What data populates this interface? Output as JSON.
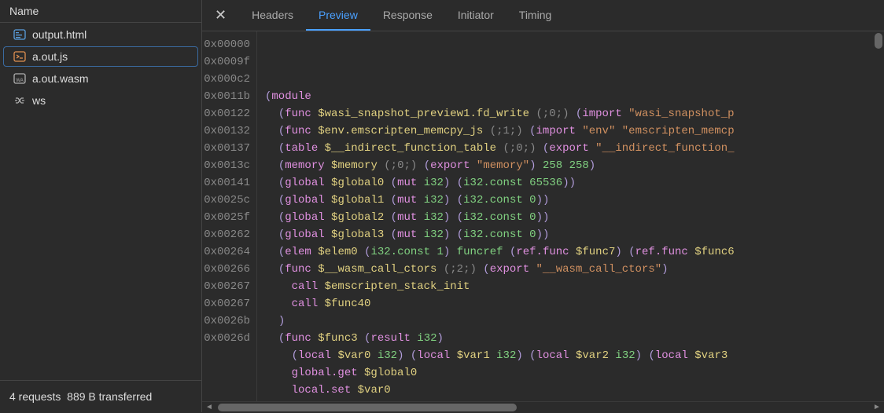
{
  "sidebar": {
    "header": "Name",
    "files": [
      {
        "name": "output.html",
        "icon": "html-icon",
        "selected": false
      },
      {
        "name": "a.out.js",
        "icon": "js-icon",
        "selected": true
      },
      {
        "name": "a.out.wasm",
        "icon": "wasm-icon",
        "selected": false
      },
      {
        "name": "ws",
        "icon": "ws-icon",
        "selected": false
      }
    ],
    "footer": {
      "requests": "4 requests",
      "transferred": "889 B transferred"
    }
  },
  "tabs": {
    "close": "✕",
    "items": [
      {
        "label": "Headers",
        "active": false
      },
      {
        "label": "Preview",
        "active": true
      },
      {
        "label": "Response",
        "active": false
      },
      {
        "label": "Initiator",
        "active": false
      },
      {
        "label": "Timing",
        "active": false
      }
    ]
  },
  "code": {
    "offsets": [
      "0x00000",
      "0x0009f",
      "0x000c2",
      "0x0011b",
      "0x00122",
      "0x00132",
      "0x00137",
      "0x0013c",
      "0x00141",
      "0x0025c",
      "0x0025f",
      "0x00262",
      "0x00264",
      "0x00266",
      "0x00267",
      "0x00267",
      "0x0026b",
      "0x0026d"
    ],
    "lines": [
      [
        [
          "punc",
          "("
        ],
        [
          "kw",
          "module"
        ]
      ],
      [
        [
          "plain",
          "  "
        ],
        [
          "punc",
          "("
        ],
        [
          "kw",
          "func"
        ],
        [
          "plain",
          " "
        ],
        [
          "ident",
          "$wasi_snapshot_preview1.fd_write"
        ],
        [
          "plain",
          " "
        ],
        [
          "cmt",
          "(;0;)"
        ],
        [
          "plain",
          " "
        ],
        [
          "punc",
          "("
        ],
        [
          "kw",
          "import"
        ],
        [
          "plain",
          " "
        ],
        [
          "str",
          "\"wasi_snapshot_p"
        ]
      ],
      [
        [
          "plain",
          "  "
        ],
        [
          "punc",
          "("
        ],
        [
          "kw",
          "func"
        ],
        [
          "plain",
          " "
        ],
        [
          "ident",
          "$env.emscripten_memcpy_js"
        ],
        [
          "plain",
          " "
        ],
        [
          "cmt",
          "(;1;)"
        ],
        [
          "plain",
          " "
        ],
        [
          "punc",
          "("
        ],
        [
          "kw",
          "import"
        ],
        [
          "plain",
          " "
        ],
        [
          "str",
          "\"env\""
        ],
        [
          "plain",
          " "
        ],
        [
          "str",
          "\"emscripten_memcp"
        ]
      ],
      [
        [
          "plain",
          "  "
        ],
        [
          "punc",
          "("
        ],
        [
          "kw",
          "table"
        ],
        [
          "plain",
          " "
        ],
        [
          "ident",
          "$__indirect_function_table"
        ],
        [
          "plain",
          " "
        ],
        [
          "cmt",
          "(;0;)"
        ],
        [
          "plain",
          " "
        ],
        [
          "punc",
          "("
        ],
        [
          "kw",
          "export"
        ],
        [
          "plain",
          " "
        ],
        [
          "str",
          "\"__indirect_function_"
        ]
      ],
      [
        [
          "plain",
          "  "
        ],
        [
          "punc",
          "("
        ],
        [
          "kw",
          "memory"
        ],
        [
          "plain",
          " "
        ],
        [
          "ident",
          "$memory"
        ],
        [
          "plain",
          " "
        ],
        [
          "cmt",
          "(;0;)"
        ],
        [
          "plain",
          " "
        ],
        [
          "punc",
          "("
        ],
        [
          "kw",
          "export"
        ],
        [
          "plain",
          " "
        ],
        [
          "str",
          "\"memory\""
        ],
        [
          "punc",
          ")"
        ],
        [
          "plain",
          " "
        ],
        [
          "num",
          "258"
        ],
        [
          "plain",
          " "
        ],
        [
          "num",
          "258"
        ],
        [
          "punc",
          ")"
        ]
      ],
      [
        [
          "plain",
          "  "
        ],
        [
          "punc",
          "("
        ],
        [
          "kw",
          "global"
        ],
        [
          "plain",
          " "
        ],
        [
          "ident",
          "$global0"
        ],
        [
          "plain",
          " "
        ],
        [
          "punc",
          "("
        ],
        [
          "kw",
          "mut"
        ],
        [
          "plain",
          " "
        ],
        [
          "type",
          "i32"
        ],
        [
          "punc",
          ")"
        ],
        [
          "plain",
          " "
        ],
        [
          "punc",
          "("
        ],
        [
          "type",
          "i32.const"
        ],
        [
          "plain",
          " "
        ],
        [
          "num",
          "65536"
        ],
        [
          "punc",
          "))"
        ]
      ],
      [
        [
          "plain",
          "  "
        ],
        [
          "punc",
          "("
        ],
        [
          "kw",
          "global"
        ],
        [
          "plain",
          " "
        ],
        [
          "ident",
          "$global1"
        ],
        [
          "plain",
          " "
        ],
        [
          "punc",
          "("
        ],
        [
          "kw",
          "mut"
        ],
        [
          "plain",
          " "
        ],
        [
          "type",
          "i32"
        ],
        [
          "punc",
          ")"
        ],
        [
          "plain",
          " "
        ],
        [
          "punc",
          "("
        ],
        [
          "type",
          "i32.const"
        ],
        [
          "plain",
          " "
        ],
        [
          "num",
          "0"
        ],
        [
          "punc",
          "))"
        ]
      ],
      [
        [
          "plain",
          "  "
        ],
        [
          "punc",
          "("
        ],
        [
          "kw",
          "global"
        ],
        [
          "plain",
          " "
        ],
        [
          "ident",
          "$global2"
        ],
        [
          "plain",
          " "
        ],
        [
          "punc",
          "("
        ],
        [
          "kw",
          "mut"
        ],
        [
          "plain",
          " "
        ],
        [
          "type",
          "i32"
        ],
        [
          "punc",
          ")"
        ],
        [
          "plain",
          " "
        ],
        [
          "punc",
          "("
        ],
        [
          "type",
          "i32.const"
        ],
        [
          "plain",
          " "
        ],
        [
          "num",
          "0"
        ],
        [
          "punc",
          "))"
        ]
      ],
      [
        [
          "plain",
          "  "
        ],
        [
          "punc",
          "("
        ],
        [
          "kw",
          "global"
        ],
        [
          "plain",
          " "
        ],
        [
          "ident",
          "$global3"
        ],
        [
          "plain",
          " "
        ],
        [
          "punc",
          "("
        ],
        [
          "kw",
          "mut"
        ],
        [
          "plain",
          " "
        ],
        [
          "type",
          "i32"
        ],
        [
          "punc",
          ")"
        ],
        [
          "plain",
          " "
        ],
        [
          "punc",
          "("
        ],
        [
          "type",
          "i32.const"
        ],
        [
          "plain",
          " "
        ],
        [
          "num",
          "0"
        ],
        [
          "punc",
          "))"
        ]
      ],
      [
        [
          "plain",
          "  "
        ],
        [
          "punc",
          "("
        ],
        [
          "kw",
          "elem"
        ],
        [
          "plain",
          " "
        ],
        [
          "ident",
          "$elem0"
        ],
        [
          "plain",
          " "
        ],
        [
          "punc",
          "("
        ],
        [
          "type",
          "i32.const"
        ],
        [
          "plain",
          " "
        ],
        [
          "num",
          "1"
        ],
        [
          "punc",
          ")"
        ],
        [
          "plain",
          " "
        ],
        [
          "type",
          "funcref"
        ],
        [
          "plain",
          " "
        ],
        [
          "punc",
          "("
        ],
        [
          "kw",
          "ref.func"
        ],
        [
          "plain",
          " "
        ],
        [
          "ident",
          "$func7"
        ],
        [
          "punc",
          ")"
        ],
        [
          "plain",
          " "
        ],
        [
          "punc",
          "("
        ],
        [
          "kw",
          "ref.func"
        ],
        [
          "plain",
          " "
        ],
        [
          "ident",
          "$func6"
        ]
      ],
      [
        [
          "plain",
          "  "
        ],
        [
          "punc",
          "("
        ],
        [
          "kw",
          "func"
        ],
        [
          "plain",
          " "
        ],
        [
          "ident",
          "$__wasm_call_ctors"
        ],
        [
          "plain",
          " "
        ],
        [
          "cmt",
          "(;2;)"
        ],
        [
          "plain",
          " "
        ],
        [
          "punc",
          "("
        ],
        [
          "kw",
          "export"
        ],
        [
          "plain",
          " "
        ],
        [
          "str",
          "\"__wasm_call_ctors\""
        ],
        [
          "punc",
          ")"
        ]
      ],
      [
        [
          "plain",
          "    "
        ],
        [
          "kw",
          "call"
        ],
        [
          "plain",
          " "
        ],
        [
          "ident",
          "$emscripten_stack_init"
        ]
      ],
      [
        [
          "plain",
          "    "
        ],
        [
          "kw",
          "call"
        ],
        [
          "plain",
          " "
        ],
        [
          "ident",
          "$func40"
        ]
      ],
      [
        [
          "plain",
          "  "
        ],
        [
          "punc",
          ")"
        ]
      ],
      [
        [
          "plain",
          "  "
        ],
        [
          "punc",
          "("
        ],
        [
          "kw",
          "func"
        ],
        [
          "plain",
          " "
        ],
        [
          "ident",
          "$func3"
        ],
        [
          "plain",
          " "
        ],
        [
          "punc",
          "("
        ],
        [
          "kw",
          "result"
        ],
        [
          "plain",
          " "
        ],
        [
          "type",
          "i32"
        ],
        [
          "punc",
          ")"
        ]
      ],
      [
        [
          "plain",
          "    "
        ],
        [
          "punc",
          "("
        ],
        [
          "kw",
          "local"
        ],
        [
          "plain",
          " "
        ],
        [
          "ident",
          "$var0"
        ],
        [
          "plain",
          " "
        ],
        [
          "type",
          "i32"
        ],
        [
          "punc",
          ")"
        ],
        [
          "plain",
          " "
        ],
        [
          "punc",
          "("
        ],
        [
          "kw",
          "local"
        ],
        [
          "plain",
          " "
        ],
        [
          "ident",
          "$var1"
        ],
        [
          "plain",
          " "
        ],
        [
          "type",
          "i32"
        ],
        [
          "punc",
          ")"
        ],
        [
          "plain",
          " "
        ],
        [
          "punc",
          "("
        ],
        [
          "kw",
          "local"
        ],
        [
          "plain",
          " "
        ],
        [
          "ident",
          "$var2"
        ],
        [
          "plain",
          " "
        ],
        [
          "type",
          "i32"
        ],
        [
          "punc",
          ")"
        ],
        [
          "plain",
          " "
        ],
        [
          "punc",
          "("
        ],
        [
          "kw",
          "local"
        ],
        [
          "plain",
          " "
        ],
        [
          "ident",
          "$var3"
        ]
      ],
      [
        [
          "plain",
          "    "
        ],
        [
          "kw",
          "global.get"
        ],
        [
          "plain",
          " "
        ],
        [
          "ident",
          "$global0"
        ]
      ],
      [
        [
          "plain",
          "    "
        ],
        [
          "kw",
          "local.set"
        ],
        [
          "plain",
          " "
        ],
        [
          "ident",
          "$var0"
        ]
      ]
    ]
  }
}
